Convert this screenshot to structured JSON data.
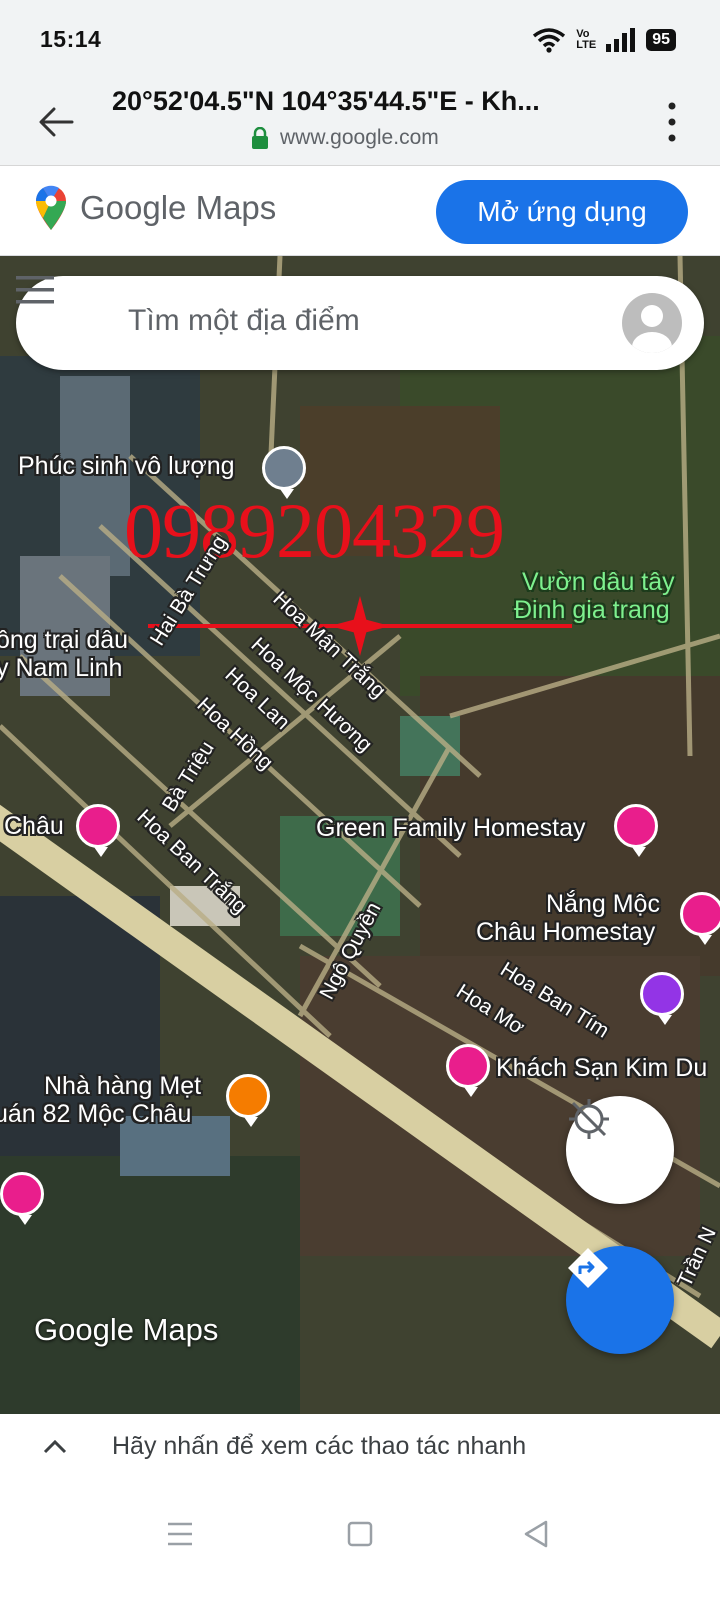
{
  "status_bar": {
    "time": "15:14",
    "volte_top": "Vo",
    "volte_bottom": "LTE",
    "battery": "95",
    "icons": [
      "wifi-icon",
      "volte-icon",
      "signal-icon",
      "battery-icon"
    ]
  },
  "browser": {
    "page_title": "20°52'04.5\"N 104°35'44.5\"E - Kh...",
    "domain": "www.google.com",
    "icons": [
      "back-arrow-icon",
      "lock-icon",
      "more-vert-icon"
    ]
  },
  "maps_header": {
    "logo_text": "Google Maps",
    "open_app_label": "Mở ứng dụng"
  },
  "search": {
    "placeholder": "Tìm một địa điểm"
  },
  "map": {
    "watermark_phone": "0989204329",
    "bottom_logo": "Google Maps",
    "places": {
      "phuc_sinh": "Phúc sinh vô lượng",
      "vuon_dau_1": "Vườn dâu tây",
      "vuon_dau_2": "Đinh gia trang",
      "nong_trai_1": "ông trại dâu",
      "nong_trai_2": "y Nam Linh",
      "chau": "Châu",
      "green_family": "Green Family Homestay",
      "nang_moc_1": "Nắng Mộc",
      "nang_moc_2": "Châu Homestay",
      "kim_du": "Khách Sạn Kim Du",
      "nha_hang_1": "Nhà hàng Mẹt",
      "nha_hang_2": "uán 82 Mộc Châu"
    },
    "streets": {
      "hai_ba_trung": "Hai Bà Trưng",
      "hoa_man_trang": "Hoa Mận Trắng",
      "hoa_moc_huong": "Hoa Mộc Hương",
      "hoa_lan": "Hoa Lan",
      "hoa_hong": "Hoa Hồng",
      "ba_trieu": "Bà Triệu",
      "hoa_ban_trang": "Hoa Ban Trắng",
      "ngo_quyen": "Ngô Quyền",
      "hoa_ban_tim": "Hoa Ban Tím",
      "hoa_mo": "Hoa Mơ",
      "tran": "Trần N"
    }
  },
  "bottom_sheet": {
    "hint": "Hãy nhấn để xem các thao tác nhanh"
  },
  "colors": {
    "accent": "#1a73e8",
    "hotel_pin": "#e91e8c",
    "food_pin": "#f57c00",
    "watermark_red": "#e8101b",
    "place_green": "#7ef08e"
  }
}
